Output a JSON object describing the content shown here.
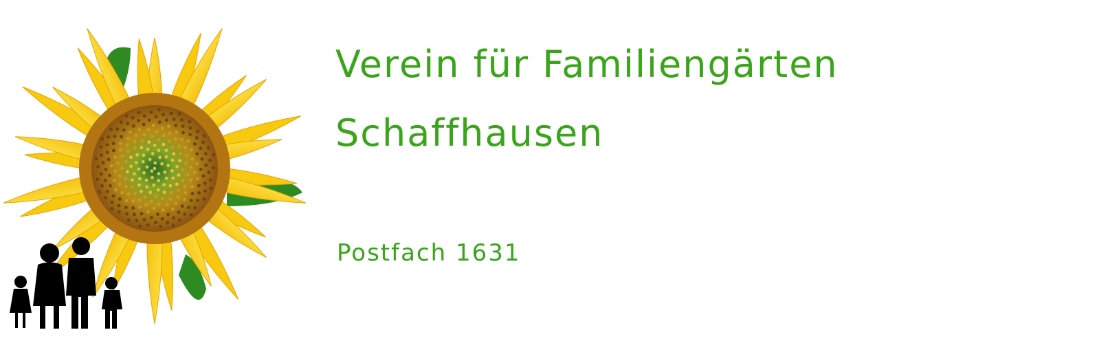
{
  "header": {
    "title_line_1": "Verein für Familiengärten",
    "title_line_2": "Schaffhausen",
    "postbox": "Postfach 1631"
  },
  "logo": {
    "icon": "sunflower-family-logo",
    "colors": {
      "petal": "#f7c90f",
      "petal_dark": "#e7a100",
      "leaf": "#2e8b22",
      "seed_outer": "#a0661a",
      "seed_inner": "#6e8a1e",
      "silhouette": "#000000"
    }
  },
  "theme": {
    "text_color": "#3aa41a",
    "background": "#ffffff"
  }
}
